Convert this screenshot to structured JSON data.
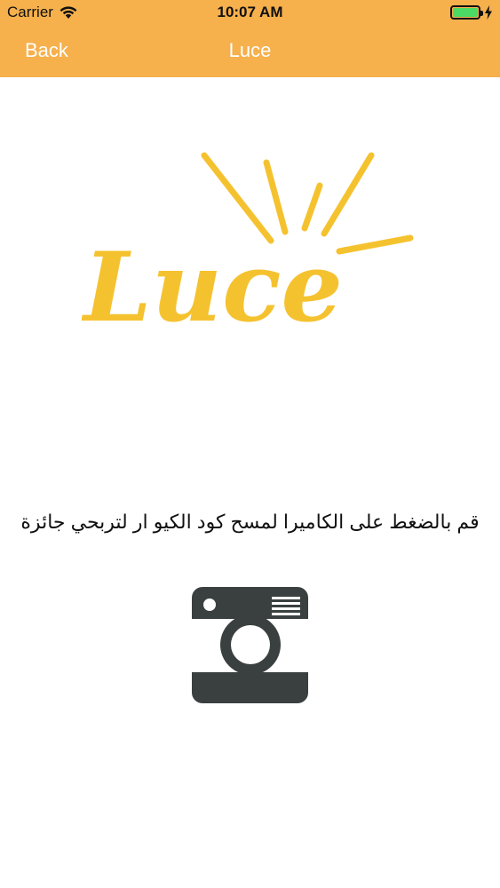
{
  "status_bar": {
    "carrier": "Carrier",
    "time": "10:07 AM",
    "battery_level": 1.0,
    "wifi_icon": "wifi-icon",
    "battery_icon": "battery-icon",
    "charging_icon": "bolt-icon"
  },
  "nav": {
    "back_label": "Back",
    "title": "Luce"
  },
  "logo": {
    "text": "Luce",
    "icon": "sun-rays-icon"
  },
  "main": {
    "instruction": "قم بالضغط على الكاميرا لمسح كود الكيو ار لتربحي جائزة",
    "camera_icon": "camera-icon"
  },
  "colors": {
    "accent": "#f6b04c",
    "logo": "#f5c22f",
    "camera": "#3a403f",
    "battery": "#4cd964"
  }
}
